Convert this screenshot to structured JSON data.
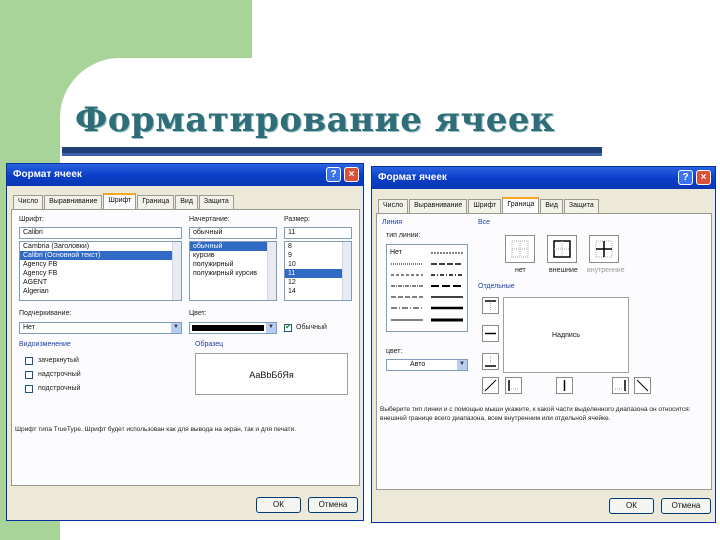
{
  "slide": {
    "title": "Форматирование ячеек",
    "colors": {
      "green": "#a8d49a",
      "title": "#2f6e78",
      "bar": "#1f3f77"
    }
  },
  "dialog1": {
    "title": "Формат ячеек",
    "title_buttons": [
      "?",
      "×"
    ],
    "tabs": [
      "Число",
      "Выравнивание",
      "Шрифт",
      "Граница",
      "Вид",
      "Защита"
    ],
    "active_tab": "Шрифт",
    "font_label": "Шрифт:",
    "font_value": "Calibri",
    "font_list": [
      "Cambria (Заголовки)",
      "Calibri (Основной текст)",
      "Agency FB",
      "Agency FB",
      "AGENT",
      "Algerian"
    ],
    "style_label": "Начертание:",
    "style_value": "обычный",
    "style_list": [
      "обычный",
      "курсив",
      "полужирный",
      "полужирный курсив"
    ],
    "size_label": "Размер:",
    "size_value": "11",
    "size_list": [
      "8",
      "9",
      "10",
      "11",
      "12",
      "14"
    ],
    "underline_label": "Подчеркивание:",
    "underline_value": "Нет",
    "color_label": "Цвет:",
    "normal_label": "Обычный",
    "effects_label": "Видоизменение",
    "effects": [
      "зачеркнутый",
      "надстрочный",
      "подстрочный"
    ],
    "sample_label": "Образец",
    "sample_text": "АаВbБбЯя",
    "info_text": "Шрифт типа TrueType. Шрифт будет использован как для вывода на экран, так и для печати.",
    "ok": "ОК",
    "cancel": "Отмена"
  },
  "dialog2": {
    "title": "Формат ячеек",
    "title_buttons": [
      "?",
      "×"
    ],
    "tabs": [
      "Число",
      "Выравнивание",
      "Шрифт",
      "Граница",
      "Вид",
      "Защита"
    ],
    "active_tab": "Граница",
    "line_label": "Линия",
    "type_label": "тип линии:",
    "none_label": "Нет",
    "all_label": "Все",
    "presets": [
      "нет",
      "внешние",
      "внутренние"
    ],
    "border_label": "Отдельные",
    "preview_text": "Надпись",
    "color_label": "цвет:",
    "color_value": "Авто",
    "hint_text": "Выберите тип линии и с помощью мыши укажите, к какой части выделенного диапазона он относится: внешней границе всего диапазона, всем внутренним или отдельной ячейке.",
    "ok": "ОК",
    "cancel": "Отмена"
  }
}
